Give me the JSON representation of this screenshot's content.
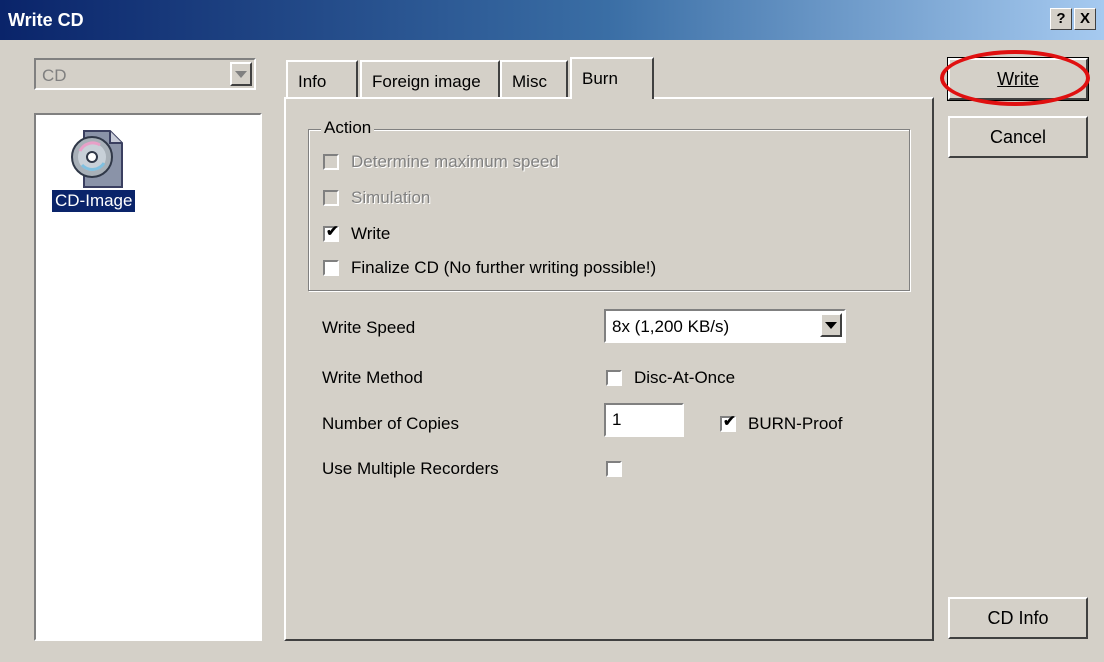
{
  "window": {
    "title": "Write CD",
    "help_btn": "?",
    "close_btn": "X"
  },
  "drive": {
    "value": "CD"
  },
  "files": [
    {
      "label": "CD-Image",
      "icon": "cd-image-icon"
    }
  ],
  "tabs": [
    {
      "label": "Info"
    },
    {
      "label": "Foreign image"
    },
    {
      "label": "Misc"
    },
    {
      "label": "Burn",
      "active": true
    }
  ],
  "action": {
    "title": "Action",
    "options": [
      {
        "label": "Determine maximum speed",
        "checked": false,
        "disabled": true
      },
      {
        "label": "Simulation",
        "checked": false,
        "disabled": true
      },
      {
        "label": "Write",
        "checked": true,
        "disabled": false
      },
      {
        "label": "Finalize CD (No further writing possible!)",
        "checked": false,
        "disabled": false
      }
    ]
  },
  "settings": {
    "write_speed_label": "Write Speed",
    "write_speed_value": "8x (1,200 KB/s)",
    "write_method_label": "Write Method",
    "dao_label": "Disc-At-Once",
    "dao_checked": false,
    "copies_label": "Number of Copies",
    "copies_value": "1",
    "burnproof_label": "BURN-Proof",
    "burnproof_checked": true,
    "multi_label": "Use Multiple Recorders",
    "multi_checked": false
  },
  "buttons": {
    "write": "Write",
    "cancel": "Cancel",
    "cd_info": "CD Info"
  },
  "colors": {
    "title_start": "#0a246a",
    "title_end": "#a6caf0",
    "face": "#d4d0c8",
    "highlight": "#e01010",
    "selection": "#0a246a"
  }
}
